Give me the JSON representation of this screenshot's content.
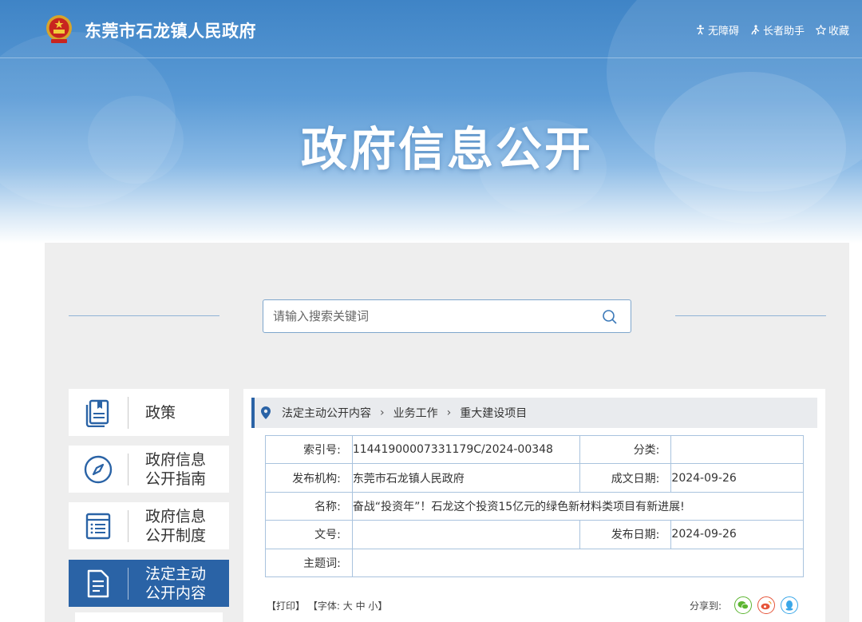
{
  "header": {
    "site_title": "东莞市石龙镇人民政府",
    "links": [
      {
        "label": "无障碍",
        "icon": "accessibility-icon"
      },
      {
        "label": "长者助手",
        "icon": "elder-assist-icon"
      },
      {
        "label": "收藏",
        "icon": "star-icon"
      }
    ],
    "banner_title": "政府信息公开"
  },
  "search": {
    "placeholder": "请输入搜索关键词"
  },
  "sidebar": {
    "items": [
      {
        "label": "政策",
        "icon": "policy-book-icon",
        "active": false
      },
      {
        "label": "政府信息\n公开指南",
        "icon": "compass-icon",
        "active": false
      },
      {
        "label": "政府信息\n公开制度",
        "icon": "list-document-icon",
        "active": false
      },
      {
        "label": "法定主动\n公开内容",
        "icon": "document-icon",
        "active": true
      }
    ]
  },
  "breadcrumb": {
    "items": [
      "法定主动公开内容",
      "业务工作",
      "重大建设项目"
    ]
  },
  "meta": {
    "index_label": "索引号:",
    "index_value": "11441900007331179C/2024-00348",
    "category_label": "分类:",
    "category_value": "",
    "publisher_label": "发布机构:",
    "publisher_value": "东莞市石龙镇人民政府",
    "created_label": "成文日期:",
    "created_value": "2024-09-26",
    "name_label": "名称:",
    "name_value": "奋战“投资年”！石龙这个投资15亿元的绿色新材料类项目有新进展!",
    "docno_label": "文号:",
    "docno_value": "",
    "published_label": "发布日期:",
    "published_value": "2024-09-26",
    "keywords_label": "主题词:",
    "keywords_value": ""
  },
  "tools": {
    "print": "【打印】",
    "font_prefix": "【字体:",
    "font_large": "大",
    "font_medium": "中",
    "font_small": "小",
    "font_suffix": "】",
    "share_label": "分享到:"
  },
  "colors": {
    "accent": "#2a63a6",
    "banner": "#4a8ccc",
    "wechat": "#5cb531",
    "weibo": "#e6553a",
    "qq": "#3aa7e8"
  }
}
